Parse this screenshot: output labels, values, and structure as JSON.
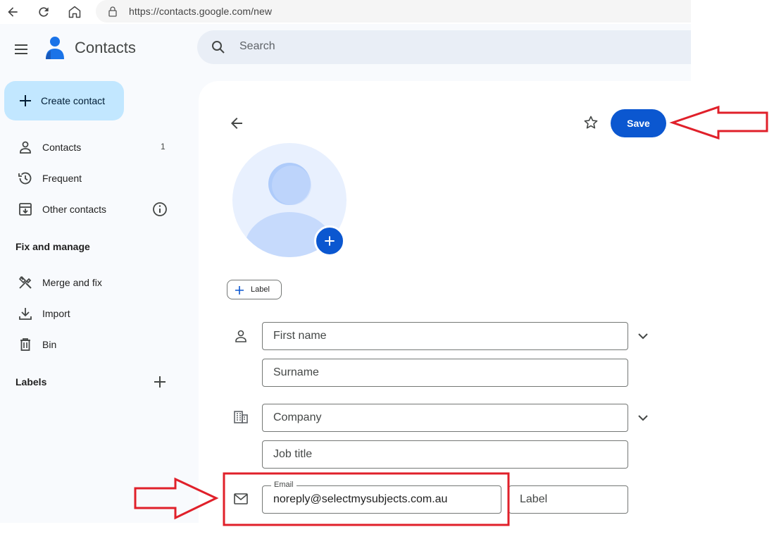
{
  "browser": {
    "url": "https://contacts.google.com/new"
  },
  "header": {
    "app_name": "Contacts",
    "search_placeholder": "Search"
  },
  "sidebar": {
    "create_label": "Create contact",
    "items": [
      {
        "label": "Contacts",
        "count": "1",
        "icon": "person-icon"
      },
      {
        "label": "Frequent",
        "icon": "history-icon"
      },
      {
        "label": "Other contacts",
        "icon": "archive-download-icon"
      }
    ],
    "fix_heading": "Fix and manage",
    "fix_items": [
      {
        "label": "Merge and fix",
        "icon": "tools-icon"
      },
      {
        "label": "Import",
        "icon": "download-icon"
      },
      {
        "label": "Bin",
        "icon": "trash-icon"
      }
    ],
    "labels_heading": "Labels"
  },
  "editor": {
    "save_label": "Save",
    "label_chip": "Label",
    "fields": {
      "first_name": {
        "placeholder": "First name",
        "value": ""
      },
      "surname": {
        "placeholder": "Surname",
        "value": ""
      },
      "company": {
        "placeholder": "Company",
        "value": ""
      },
      "job_title": {
        "placeholder": "Job title",
        "value": ""
      },
      "email": {
        "label": "Email",
        "value": "noreply@selectmysubjects.com.au"
      },
      "email_label": {
        "placeholder": "Label",
        "value": ""
      }
    }
  },
  "colors": {
    "accent": "#0b57d0",
    "create_bg": "#c2e7ff",
    "sidebar_bg": "#f8fafd",
    "annotation": "#e0202a"
  }
}
